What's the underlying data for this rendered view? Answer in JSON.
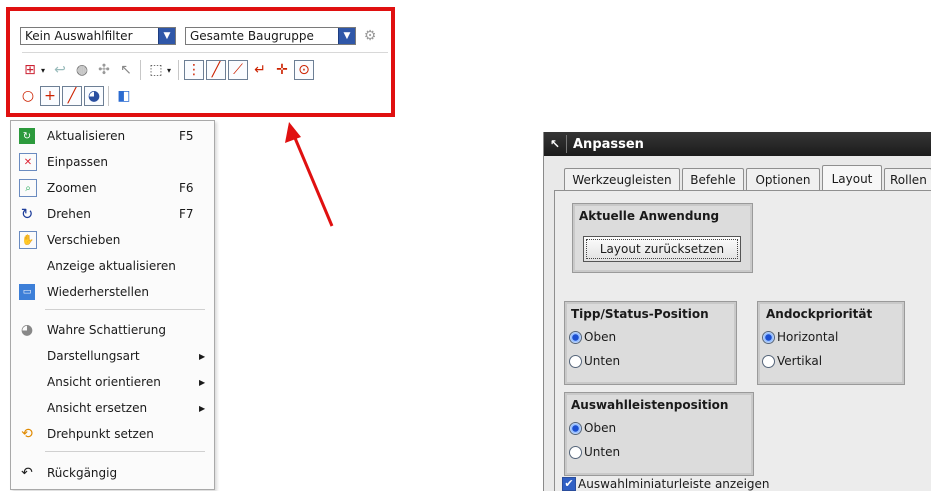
{
  "toolbar": {
    "filter_select": "Kein Auswahlfilter",
    "scope_select": "Gesamte Baugruppe",
    "colors": {
      "frame": "#e01010",
      "combo_arrow": "#2f57a8"
    },
    "icons": [
      "select-icon",
      "arrow-left-icon",
      "view-icon",
      "snap-icon",
      "point-icon",
      "rectangle-select-icon",
      "dropdown-arrow-icon",
      "all-points-icon",
      "line-icon",
      "midpoint-icon",
      "curve-icon",
      "intersection-icon",
      "circle-center-icon",
      "circle-icon",
      "crosshair-icon",
      "line-diagonal-icon",
      "sector-icon",
      "cube-icon"
    ]
  },
  "menu": {
    "items": [
      {
        "label": "Aktualisieren",
        "shortcut": "F5",
        "icon": "refresh-icon"
      },
      {
        "label": "Einpassen",
        "shortcut": "",
        "icon": "fit-icon"
      },
      {
        "label": "Zoomen",
        "shortcut": "F6",
        "icon": "zoom-icon"
      },
      {
        "label": "Drehen",
        "shortcut": "F7",
        "icon": "rotate-icon"
      },
      {
        "label": "Verschieben",
        "shortcut": "",
        "icon": "pan-icon"
      },
      {
        "label": "Anzeige aktualisieren",
        "shortcut": "",
        "icon": ""
      },
      {
        "label": "Wiederherstellen",
        "shortcut": "",
        "icon": "restore-icon"
      },
      {
        "label": "Wahre Schattierung",
        "shortcut": "",
        "icon": "shading-icon"
      },
      {
        "label": "Darstellungsart",
        "shortcut": "",
        "icon": "",
        "submenu": true
      },
      {
        "label": "Ansicht orientieren",
        "shortcut": "",
        "icon": "",
        "submenu": true
      },
      {
        "label": "Ansicht ersetzen",
        "shortcut": "",
        "icon": "",
        "submenu": true
      },
      {
        "label": "Drehpunkt setzen",
        "shortcut": "",
        "icon": "pivot-icon"
      },
      {
        "label": "Rückgängig",
        "shortcut": "",
        "icon": "undo-icon"
      }
    ]
  },
  "dialog": {
    "title": "Anpassen",
    "tabs": [
      "Werkzeugleisten",
      "Befehle",
      "Optionen",
      "Layout",
      "Rollen"
    ],
    "active_tab": "Layout",
    "group_app": {
      "title": "Aktuelle Anwendung",
      "button": "Layout zurücksetzen"
    },
    "group_tip": {
      "title": "Tipp/Status-Position",
      "options": [
        "Oben",
        "Unten"
      ],
      "selected": "Oben"
    },
    "group_dock": {
      "title": "Andockpriorität",
      "options": [
        "Horizontal",
        "Vertikal"
      ],
      "selected": "Horizontal"
    },
    "group_selbar": {
      "title": "Auswahlleistenposition",
      "options": [
        "Oben",
        "Unten"
      ],
      "selected": "Oben"
    },
    "checkbox": {
      "label": "Auswahlminiaturleiste anzeigen",
      "checked": true
    }
  },
  "annotation_color": "#e01010"
}
